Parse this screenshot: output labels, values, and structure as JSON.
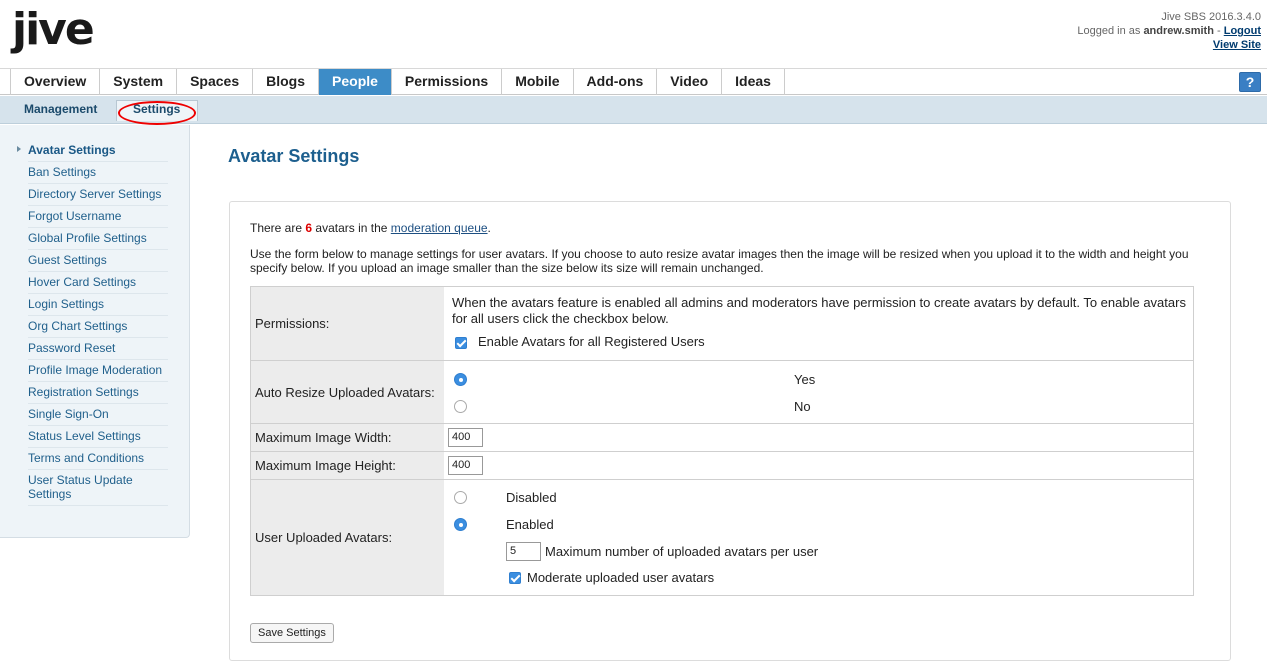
{
  "header": {
    "logo": "jive",
    "version": "Jive SBS 2016.3.4.0",
    "logged_in_prefix": "Logged in as",
    "username": "andrew.smith",
    "separator": "-",
    "logout": "Logout",
    "view_site": "View Site"
  },
  "tabs": [
    {
      "label": "Overview"
    },
    {
      "label": "System"
    },
    {
      "label": "Spaces"
    },
    {
      "label": "Blogs"
    },
    {
      "label": "People",
      "active": true
    },
    {
      "label": "Permissions"
    },
    {
      "label": "Mobile"
    },
    {
      "label": "Add-ons"
    },
    {
      "label": "Video"
    },
    {
      "label": "Ideas"
    }
  ],
  "help_label": "?",
  "subtabs": {
    "management": "Management",
    "settings": "Settings"
  },
  "sidebar": {
    "items": [
      {
        "label": "Avatar Settings"
      },
      {
        "label": "Ban Settings"
      },
      {
        "label": "Directory Server Settings"
      },
      {
        "label": "Forgot Username"
      },
      {
        "label": "Global Profile Settings"
      },
      {
        "label": "Guest Settings"
      },
      {
        "label": "Hover Card Settings"
      },
      {
        "label": "Login Settings"
      },
      {
        "label": "Org Chart Settings"
      },
      {
        "label": "Password Reset"
      },
      {
        "label": "Profile Image Moderation"
      },
      {
        "label": "Registration Settings"
      },
      {
        "label": "Single Sign-On"
      },
      {
        "label": "Status Level Settings"
      },
      {
        "label": "Terms and Conditions"
      },
      {
        "label": "User Status Update Settings"
      }
    ]
  },
  "main": {
    "title": "Avatar Settings",
    "intro_prefix": "There are",
    "intro_count": "6",
    "intro_middle": "avatars in the",
    "intro_link": "moderation queue",
    "intro_suffix": ".",
    "description": "Use the form below to manage settings for user avatars. If you choose to auto resize avatar images then the image will be resized when you upload it to the width and height you specify below. If you upload an image smaller than the size below its size will remain unchanged.",
    "permissions": {
      "label": "Permissions:",
      "text": "When the avatars feature is enabled all admins and moderators have permission to create avatars by default. To enable avatars for all users click the checkbox below.",
      "checkbox_label": "Enable Avatars for all Registered Users"
    },
    "auto_resize": {
      "label": "Auto Resize Uploaded Avatars:",
      "yes": "Yes",
      "no": "No"
    },
    "max_width": {
      "label": "Maximum Image Width:",
      "value": "400"
    },
    "max_height": {
      "label": "Maximum Image Height:",
      "value": "400"
    },
    "user_uploaded": {
      "label": "User Uploaded Avatars:",
      "disabled": "Disabled",
      "enabled": "Enabled",
      "max_count_value": "5",
      "max_count_label": "Maximum number of uploaded avatars per user",
      "moderate_label": "Moderate uploaded user avatars"
    },
    "save_button": "Save Settings"
  },
  "colors": {
    "active_tab": "#3d8cc7",
    "link": "#1f5f8b",
    "title": "#1d5f8e",
    "count": "#dd0000",
    "annotation": "#ee0000"
  }
}
